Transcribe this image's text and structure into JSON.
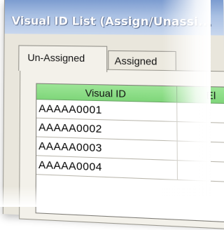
{
  "window": {
    "title": "Visual ID List (Assign/Unassi..."
  },
  "tabs": [
    {
      "label": "Un-Assigned",
      "active": true
    },
    {
      "label": "Assigned",
      "active": false
    }
  ],
  "table": {
    "columns": [
      "Visual ID",
      "El"
    ],
    "rows": [
      [
        "AAAAA0001",
        ""
      ],
      [
        "AAAAA0002",
        ""
      ],
      [
        "AAAAA0003",
        ""
      ],
      [
        "AAAAA0004",
        ""
      ]
    ]
  },
  "colors": {
    "header_green": "#8fdc8a",
    "titlebar_blue": "#a9c0e3"
  }
}
